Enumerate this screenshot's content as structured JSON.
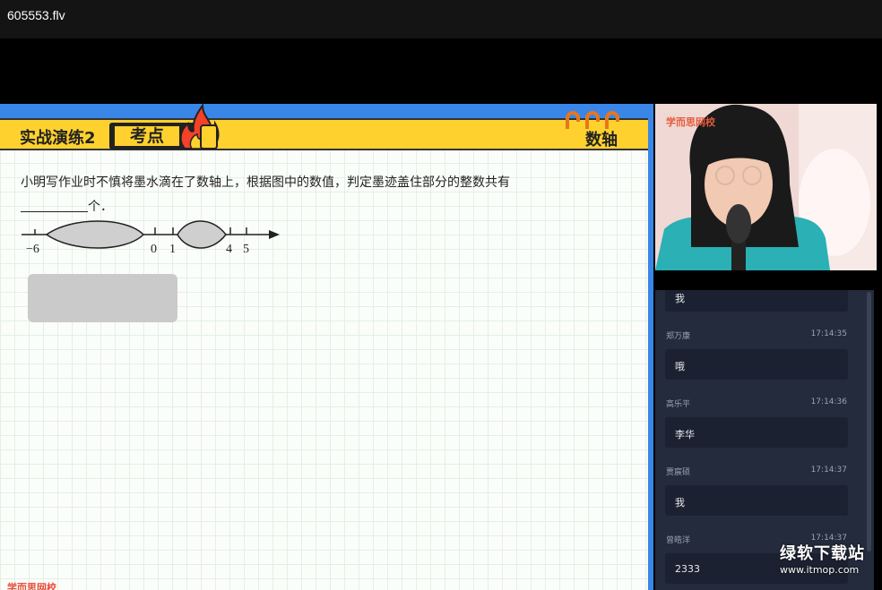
{
  "window": {
    "title": "605553.flv"
  },
  "slide": {
    "header_title": "实战演练2",
    "tag_label": "考点",
    "topic": "数轴",
    "question_text": "小明写作业时不慎将墨水滴在了数轴上，根据图中的数值，判定墨迹盖住部分的整数共有",
    "question_suffix": "个．",
    "number_line_labels": [
      "−6",
      "0",
      "1",
      "4",
      "5"
    ],
    "brand": "学而思网校"
  },
  "camera": {
    "brand": "学而思网校"
  },
  "chat": {
    "messages": [
      {
        "name": "",
        "time": "",
        "text": "我"
      },
      {
        "name": "郑万康",
        "time": "17:14:35",
        "text": "哦"
      },
      {
        "name": "高乐平",
        "time": "17:14:36",
        "text": "李华"
      },
      {
        "name": "贾宸硕",
        "time": "17:14:37",
        "text": "我"
      },
      {
        "name": "曾皓洋",
        "time": "17:14:37",
        "text": "2333"
      }
    ]
  },
  "watermark": {
    "main": "绿软下载站",
    "sub": "www.itmop.com"
  },
  "colors": {
    "accent_yellow": "#ffd12e",
    "slide_blue": "#3a86e8",
    "chat_bg": "#232b3c"
  }
}
